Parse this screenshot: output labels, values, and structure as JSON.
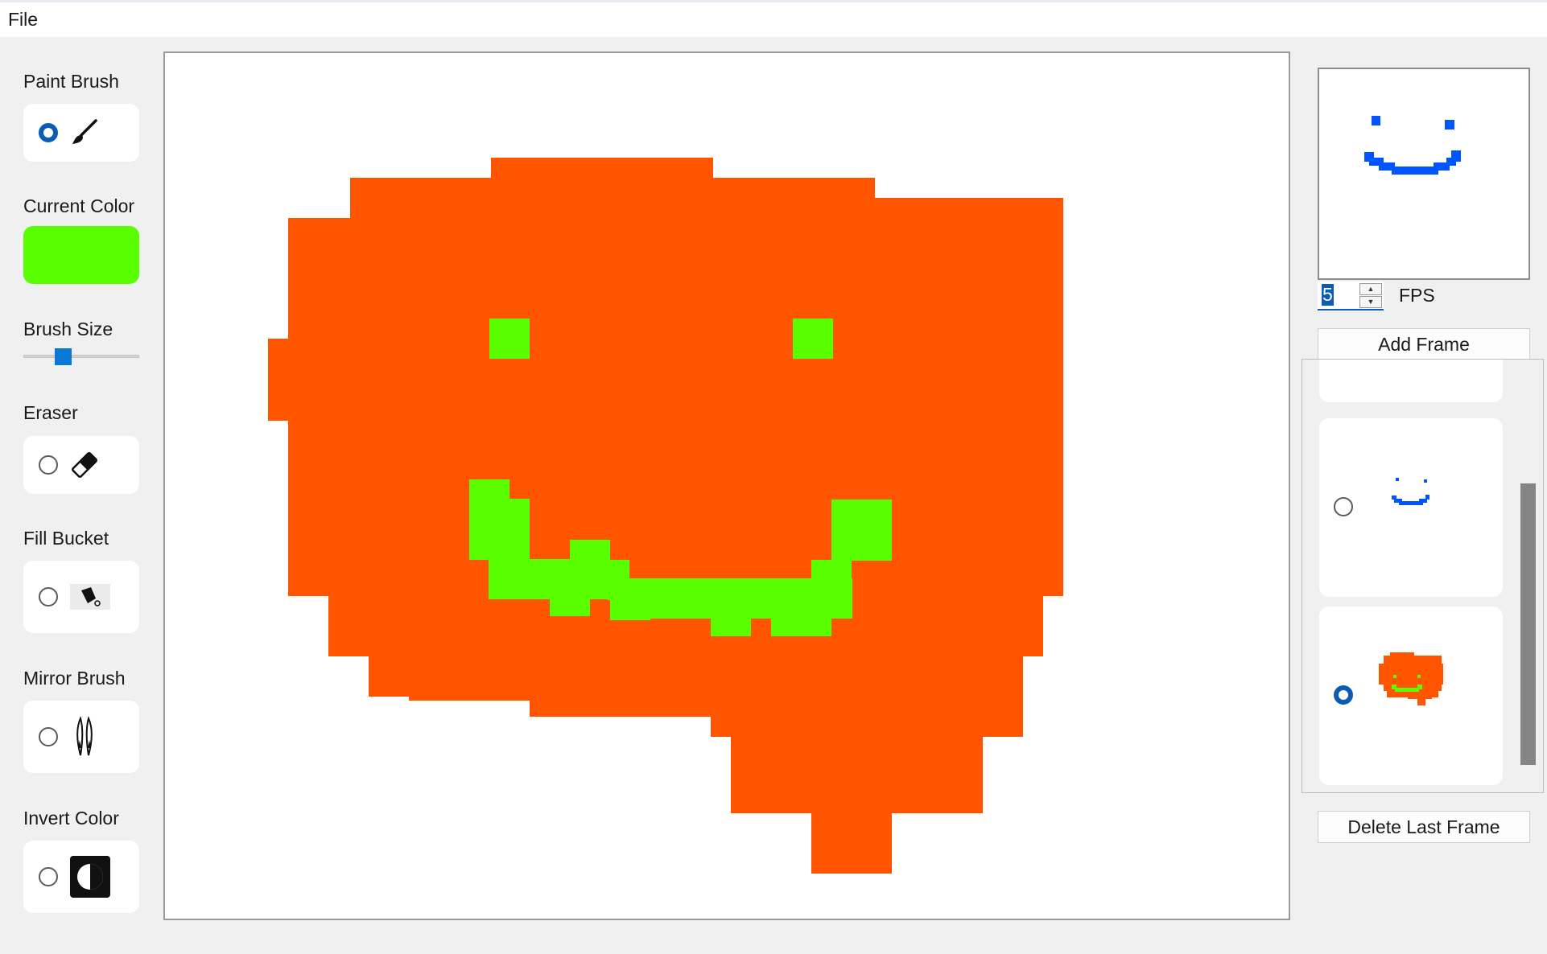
{
  "menu": {
    "file": "File"
  },
  "tools": {
    "paint_brush": {
      "label": "Paint Brush",
      "selected": true,
      "icon": "paintbrush-icon"
    },
    "current_color": {
      "label": "Current Color",
      "value": "#59ff00"
    },
    "brush_size": {
      "label": "Brush Size"
    },
    "eraser": {
      "label": "Eraser",
      "selected": false,
      "icon": "eraser-icon"
    },
    "fill_bucket": {
      "label": "Fill Bucket",
      "selected": false,
      "icon": "paint-bucket-icon"
    },
    "mirror_brush": {
      "label": "Mirror Brush",
      "selected": false,
      "icon": "mirror-brush-icon"
    },
    "invert_color": {
      "label": "Invert Color",
      "selected": false,
      "icon": "invert-color-icon"
    }
  },
  "colors": {
    "orange": "#ff5500",
    "green": "#59ff00",
    "blue": "#0055ff",
    "accent": "#0a5cb5"
  },
  "animation": {
    "fps_value": "5",
    "fps_label": "FPS",
    "add_frame_label": "Add Frame",
    "delete_last_frame_label": "Delete Last Frame",
    "frames": [
      {
        "selected": false,
        "thumbnail": "blue-smile"
      },
      {
        "selected": true,
        "thumbnail": "orange-face"
      }
    ]
  }
}
